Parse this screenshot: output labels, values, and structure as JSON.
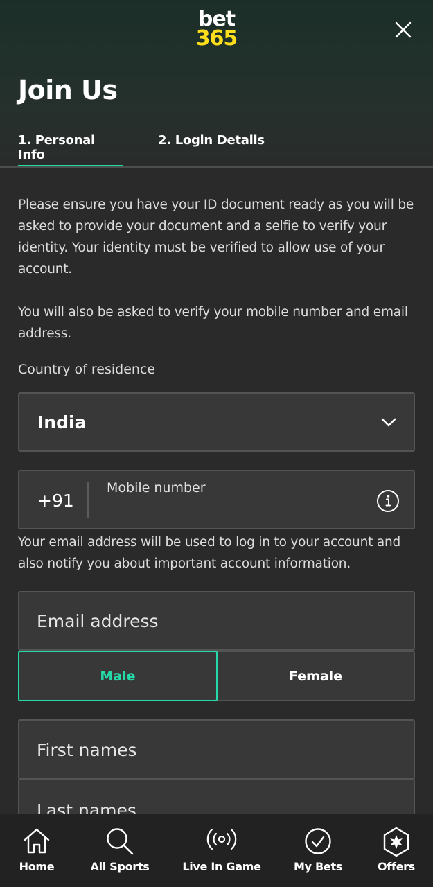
{
  "header": {
    "logo_line1": "bet",
    "logo_line2": "365",
    "title": "Join Us"
  },
  "tabs": [
    {
      "label": "1.  Personal Info",
      "active": true
    },
    {
      "label": "2.  Login Details",
      "active": false
    }
  ],
  "info": {
    "paragraph1": "Please ensure you have your ID document ready as you will be asked to provide your document and a selfie to verify your identity. Your identity must be verified to allow use of your account.",
    "paragraph2": "You will also be asked to verify your mobile number and email address."
  },
  "country": {
    "label": "Country of residence",
    "value": "India"
  },
  "mobile": {
    "prefix": "+91",
    "placeholder": "Mobile number"
  },
  "email_note": "Your email address will be used to log in to your account and also notify you about important account information.",
  "email": {
    "placeholder": "Email address"
  },
  "gender": {
    "options": [
      "Male",
      "Female"
    ],
    "selected": "Male"
  },
  "first_names": {
    "placeholder": "First names"
  },
  "last_names": {
    "placeholder": "Last names"
  },
  "bottom_nav": [
    {
      "label": "Home",
      "icon": "home-icon"
    },
    {
      "label": "All Sports",
      "icon": "search-icon"
    },
    {
      "label": "Live In Game",
      "icon": "live-broadcast-icon"
    },
    {
      "label": "My Bets",
      "icon": "check-circle-icon"
    },
    {
      "label": "Offers",
      "icon": "offers-badge-icon"
    }
  ],
  "colors": {
    "accent": "#26d9a9",
    "brand_yellow": "#ffdf1b",
    "background": "#2a2a2a"
  }
}
